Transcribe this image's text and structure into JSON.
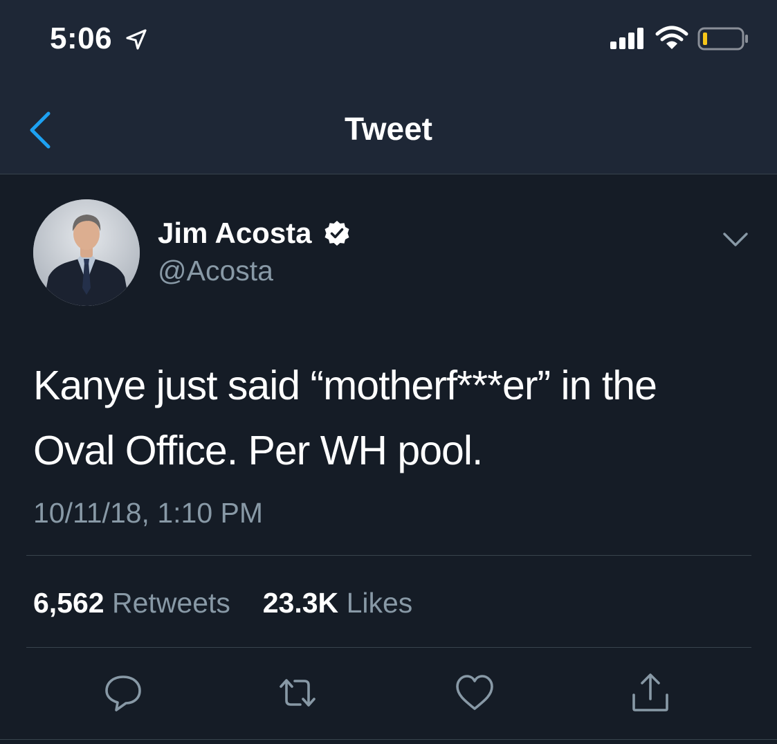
{
  "status_bar": {
    "time": "5:06",
    "icons": [
      "location-arrow-icon",
      "cellular-signal-icon",
      "wifi-icon",
      "battery-low-icon"
    ]
  },
  "nav": {
    "back_icon": "chevron-left-icon",
    "title": "Tweet"
  },
  "tweet": {
    "author": {
      "display_name": "Jim Acosta",
      "handle": "@Acosta",
      "verified": true
    },
    "text_line_1": "Kanye just said “motherf***er” in the",
    "text_line_2": "Oval Office. Per WH pool.",
    "timestamp": "10/11/18, 1:10 PM",
    "stats": {
      "retweets_count": "6,562",
      "retweets_label": "Retweets",
      "likes_count": "23.3K",
      "likes_label": "Likes"
    },
    "actions": [
      "reply-icon",
      "retweet-icon",
      "like-icon",
      "share-icon"
    ]
  },
  "colors": {
    "header_bg": "#1e2736",
    "body_bg": "#151c26",
    "accent_blue": "#1da1f2",
    "secondary_text": "#8899a6",
    "divider": "#38444d",
    "battery_low": "#f5c518"
  }
}
